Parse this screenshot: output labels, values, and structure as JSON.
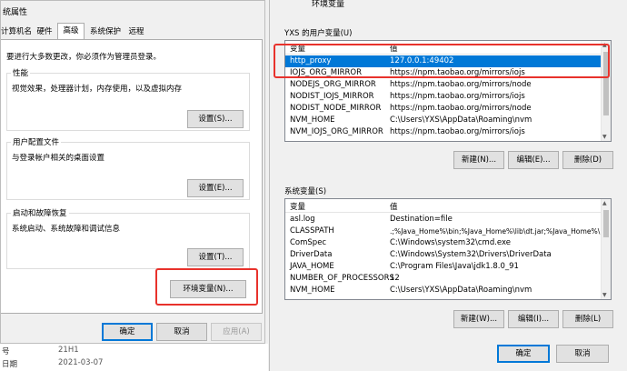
{
  "sys_props": {
    "title": "统属性",
    "tabs": [
      "计算机名",
      "硬件",
      "高级",
      "系统保护",
      "远程"
    ],
    "admin_note": "要进行大多数更改，你必须作为管理员登录。",
    "performance": {
      "title": "性能",
      "desc": "视觉效果，处理器计划，内存使用，以及虚拟内存",
      "button": "设置(S)..."
    },
    "profile": {
      "title": "用户配置文件",
      "desc": "与登录帐户相关的桌面设置",
      "button": "设置(E)..."
    },
    "startup": {
      "title": "启动和故障恢复",
      "desc": "系统启动、系统故障和调试信息",
      "button": "设置(T)..."
    },
    "env_button": "环境变量(N)...",
    "ok": "确定",
    "cancel": "取消",
    "apply": "应用(A)"
  },
  "background": {
    "row1_label": "号",
    "row1_value": "21H1",
    "row2_label": "日期",
    "row2_value": "2021-03-07"
  },
  "env_vars": {
    "title": "环境变量",
    "user_section_title": "YXS 的用户变量(U)",
    "col_var": "变量",
    "col_val": "值",
    "user_vars": [
      {
        "name": "http_proxy",
        "value": "127.0.0.1:49402"
      },
      {
        "name": "IOJS_ORG_MIRROR",
        "value": "https://npm.taobao.org/mirrors/iojs"
      },
      {
        "name": "NODEJS_ORG_MIRROR",
        "value": "https://npm.taobao.org/mirrors/node"
      },
      {
        "name": "NODIST_IOJS_MIRROR",
        "value": "https://npm.taobao.org/mirrors/iojs"
      },
      {
        "name": "NODIST_NODE_MIRROR",
        "value": "https://npm.taobao.org/mirrors/node"
      },
      {
        "name": "NVM_HOME",
        "value": "C:\\Users\\YXS\\AppData\\Roaming\\nvm"
      },
      {
        "name": "NVM_IOJS_ORG_MIRROR",
        "value": "https://npm.taobao.org/mirrors/iojs"
      }
    ],
    "user_buttons": [
      "新建(N)...",
      "编辑(E)...",
      "删除(D)"
    ],
    "system_section_title": "系统变量(S)",
    "system_vars": [
      {
        "name": "asl.log",
        "value": "Destination=file"
      },
      {
        "name": "CLASSPATH",
        "value": ".;%Java_Home%\\bin;%Java_Home%\\lib\\dt.jar;%Java_Home%\\..."
      },
      {
        "name": "ComSpec",
        "value": "C:\\Windows\\system32\\cmd.exe"
      },
      {
        "name": "DriverData",
        "value": "C:\\Windows\\System32\\Drivers\\DriverData"
      },
      {
        "name": "JAVA_HOME",
        "value": "C:\\Program Files\\Java\\jdk1.8.0_91"
      },
      {
        "name": "NUMBER_OF_PROCESSORS",
        "value": "12"
      },
      {
        "name": "NVM_HOME",
        "value": "C:\\Users\\YXS\\AppData\\Roaming\\nvm"
      }
    ],
    "system_buttons": [
      "新建(W)...",
      "编辑(I)...",
      "删除(L)"
    ],
    "ok": "确定",
    "cancel": "取消"
  }
}
